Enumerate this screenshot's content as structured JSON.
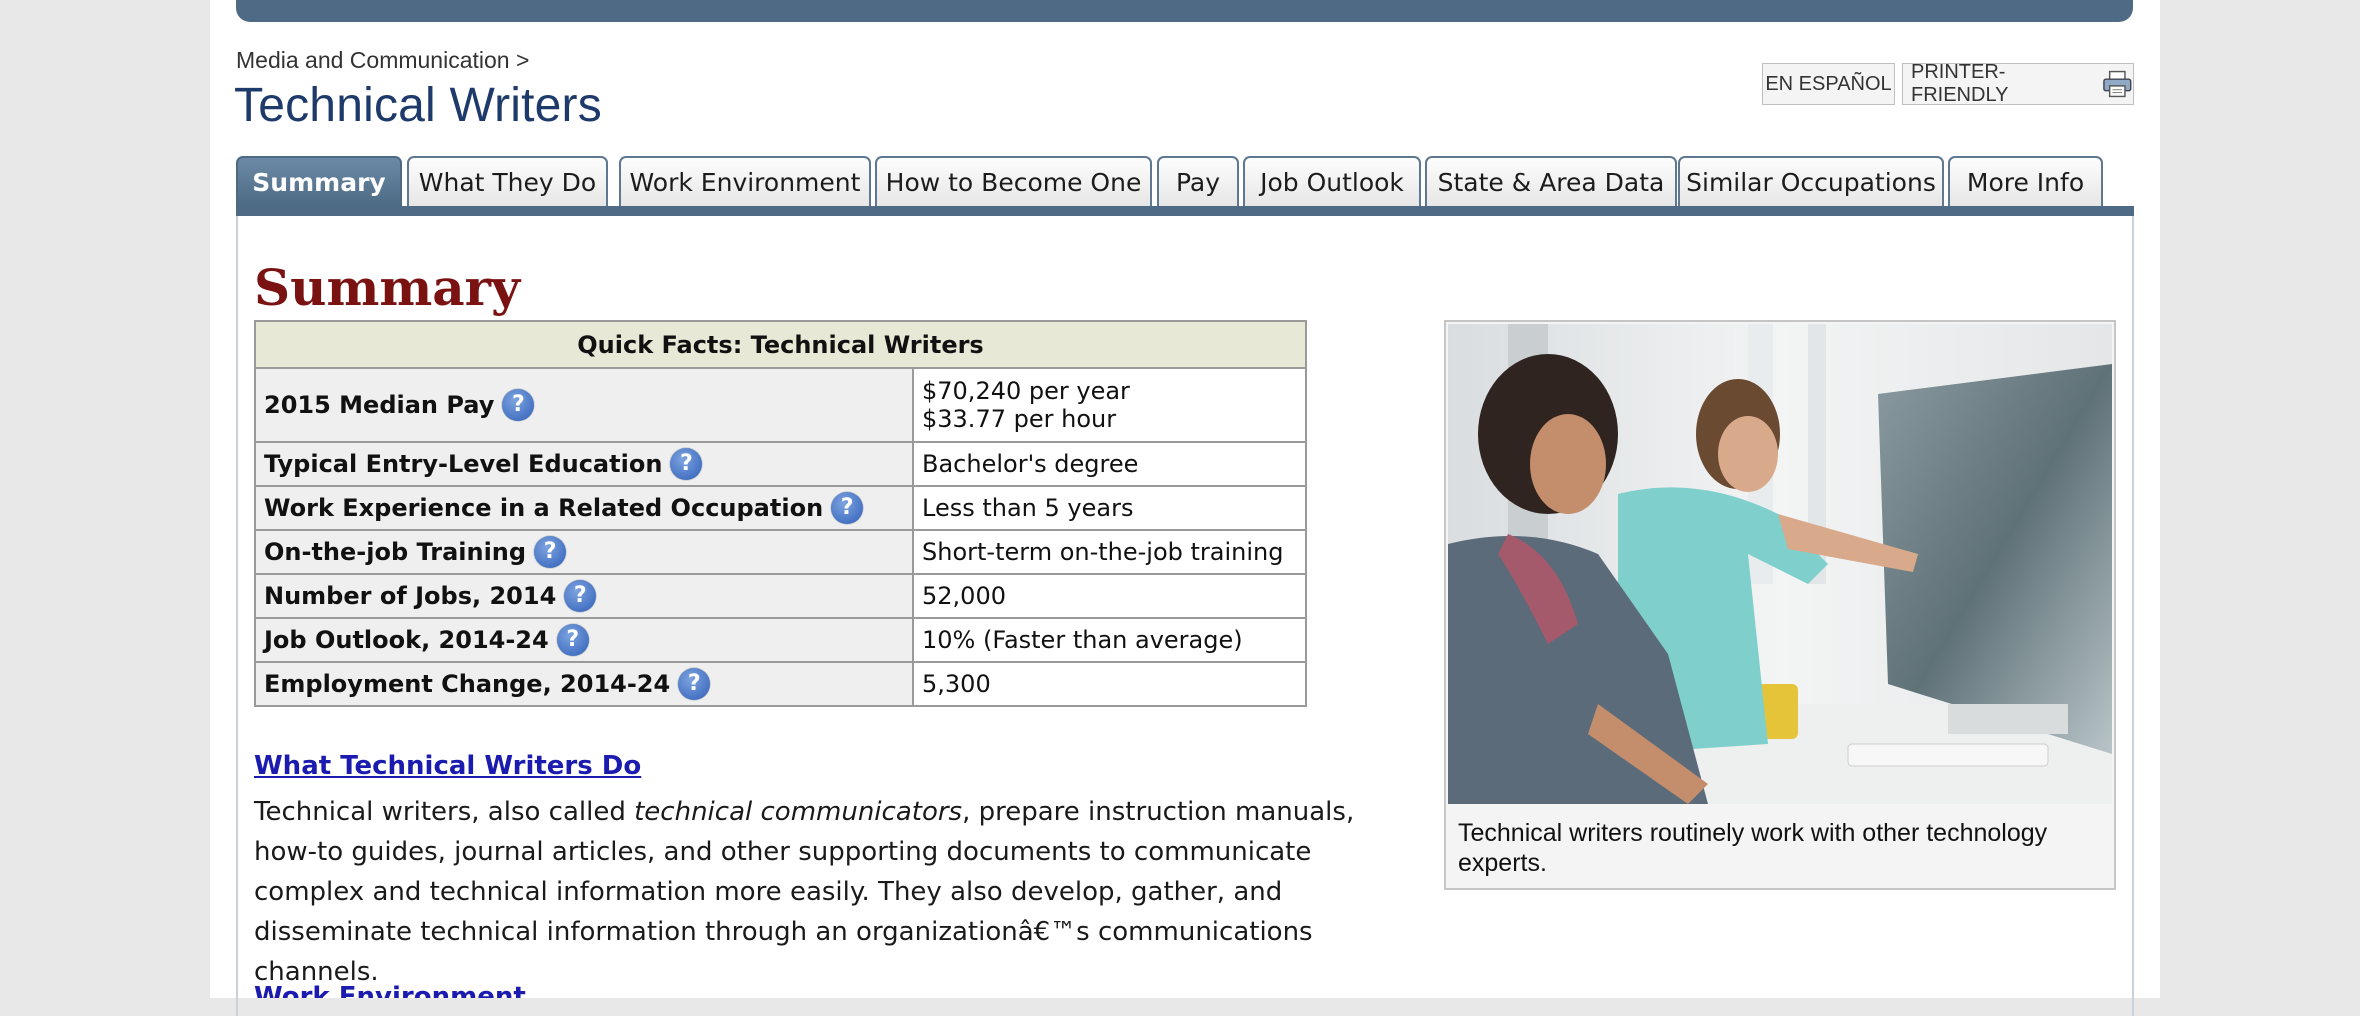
{
  "breadcrumb": "Media and Communication >",
  "title": "Technical Writers",
  "top_buttons": {
    "espanol": "EN ESPAÑOL",
    "printer": "PRINTER-FRIENDLY"
  },
  "tabs": [
    {
      "label": "Summary",
      "active": true
    },
    {
      "label": "What They Do"
    },
    {
      "label": "Work Environment"
    },
    {
      "label": "How to Become One"
    },
    {
      "label": "Pay"
    },
    {
      "label": "Job Outlook"
    },
    {
      "label": "State & Area Data"
    },
    {
      "label": "Similar Occupations"
    },
    {
      "label": "More Info"
    }
  ],
  "section_heading": "Summary",
  "quick_facts": {
    "header": "Quick Facts: Technical Writers",
    "help_icon": "?",
    "rows": [
      {
        "label": "2015 Median Pay",
        "value_line1": "$70,240 per year",
        "value_line2": "$33.77 per hour"
      },
      {
        "label": "Typical Entry-Level Education",
        "value": "Bachelor's degree"
      },
      {
        "label": "Work Experience in a Related Occupation",
        "value": "Less than 5 years"
      },
      {
        "label": "On-the-job Training",
        "value": "Short-term on-the-job training"
      },
      {
        "label": "Number of Jobs, 2014",
        "value": "52,000"
      },
      {
        "label": "Job Outlook, 2014-24",
        "value": "10% (Faster than average)"
      },
      {
        "label": "Employment Change, 2014-24",
        "value": "5,300"
      }
    ]
  },
  "what_they_do": {
    "link": "What Technical Writers Do",
    "para_before": "Technical writers, also called ",
    "para_em": "technical communicators",
    "para_after": ", prepare instruction manuals, how-to guides, journal articles, and other supporting documents to communicate complex and technical information more easily. They also develop, gather, and disseminate technical information through an organizationâ€™s communications channels."
  },
  "next_link": "Work Environment",
  "photo": {
    "caption": "Technical writers routinely work with other technology experts."
  },
  "colors": {
    "nav_blue": "#4e6a85",
    "title_blue": "#1e3a6b",
    "heading_red": "#7a1212",
    "link_blue": "#1b1bb0"
  }
}
